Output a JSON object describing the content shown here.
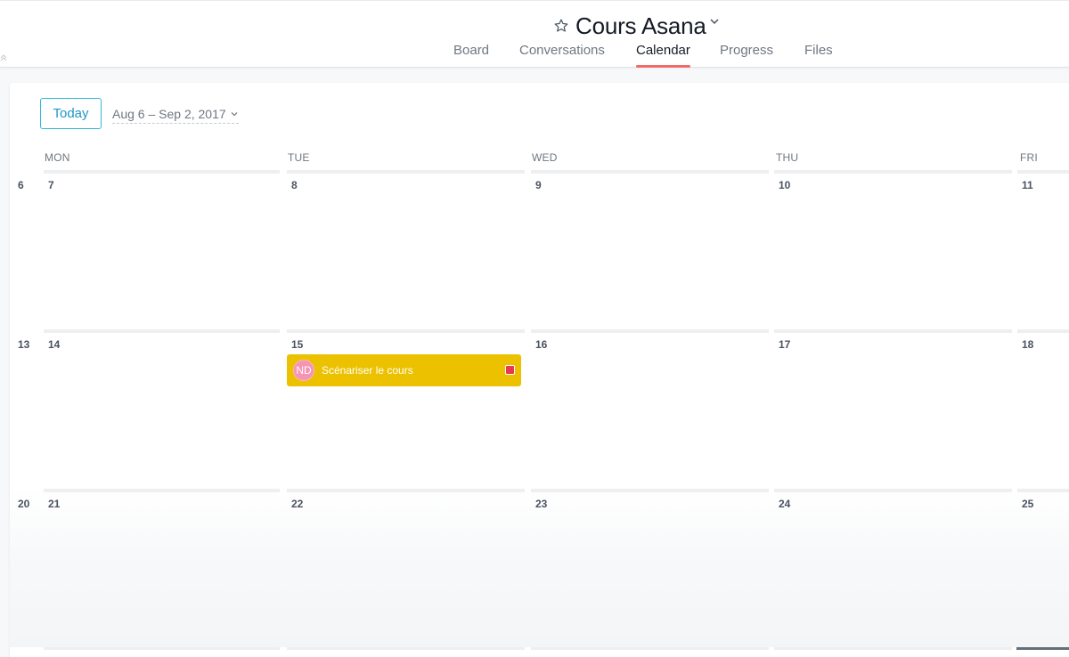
{
  "header": {
    "collapse_icon": "double-chevron-up-icon",
    "star_icon": "star-outline-icon",
    "title": "Cours Asana",
    "title_chevron_icon": "chevron-down-icon",
    "tabs": [
      {
        "label": "Board",
        "active": false
      },
      {
        "label": "Conversations",
        "active": false
      },
      {
        "label": "Calendar",
        "active": true
      },
      {
        "label": "Progress",
        "active": false
      },
      {
        "label": "Files",
        "active": false
      }
    ]
  },
  "toolbar": {
    "today_label": "Today",
    "date_range": "Aug 6 – Sep 2, 2017",
    "range_chevron_icon": "chevron-down-icon"
  },
  "calendar": {
    "weekdays": [
      "MON",
      "TUE",
      "WED",
      "THU",
      "FRI"
    ],
    "weeks": [
      {
        "week_start": "6",
        "days": [
          "7",
          "8",
          "9",
          "10",
          "11"
        ]
      },
      {
        "week_start": "13",
        "days": [
          "14",
          "15",
          "16",
          "17",
          "18"
        ]
      },
      {
        "week_start": "20",
        "days": [
          "21",
          "22",
          "23",
          "24",
          "25"
        ]
      }
    ],
    "task": {
      "assignee_initials": "ND",
      "title": "Scénariser le cours",
      "color": "#ecc200",
      "avatar_color": "#f793b3",
      "marker_color": "#e8384f"
    }
  },
  "colors": {
    "accent_tab_underline": "#f06a6a",
    "today_button_border": "#2eb8d6"
  }
}
